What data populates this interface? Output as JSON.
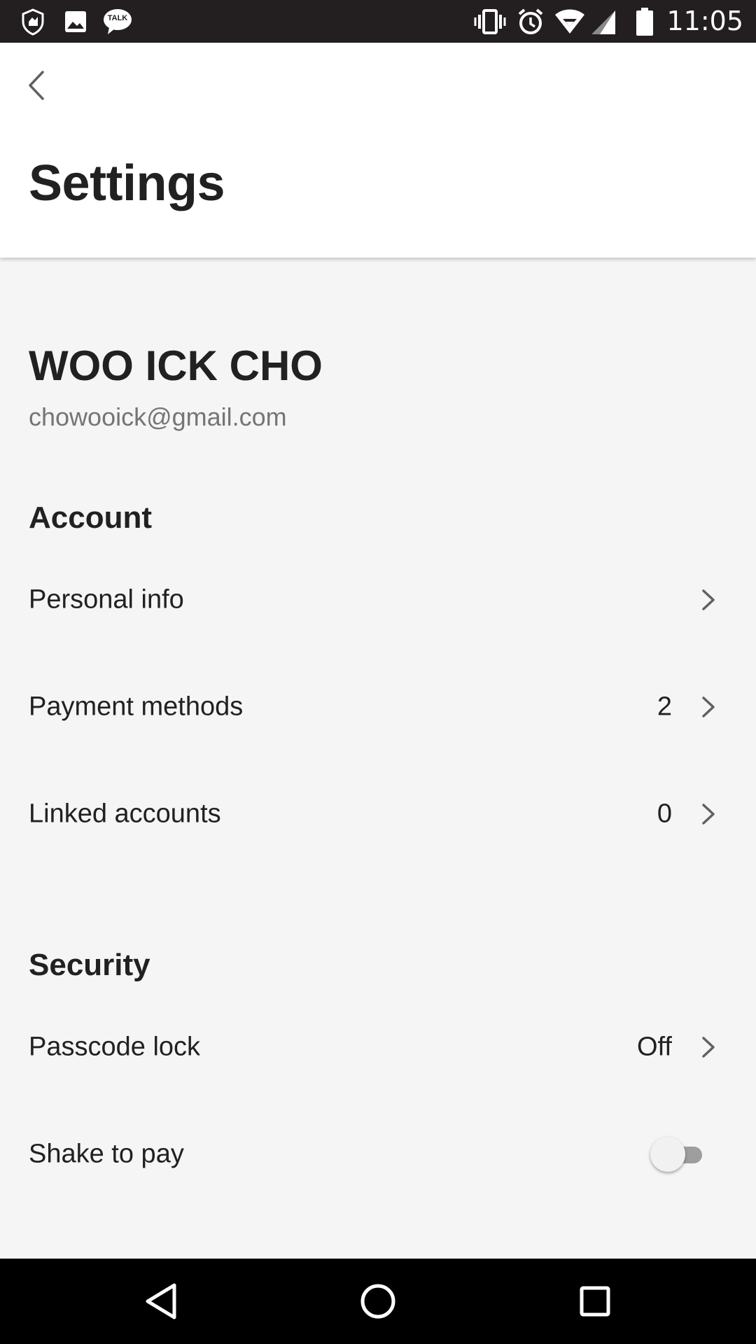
{
  "status_bar": {
    "time": "11:05",
    "left_icons": [
      "shield-notification-icon",
      "image-notification-icon",
      "talk-notification-icon"
    ],
    "talk_badge": "TALK",
    "right_icons": [
      "vibrate-icon",
      "alarm-icon",
      "wifi-icon",
      "signal-icon",
      "battery-icon"
    ]
  },
  "header": {
    "back_icon": "chevron-left-icon",
    "title": "Settings"
  },
  "profile": {
    "name": "WOO ICK CHO",
    "email": "chowooick@gmail.com"
  },
  "account": {
    "header": "Account",
    "items": [
      {
        "label": "Personal info",
        "value": ""
      },
      {
        "label": "Payment methods",
        "value": "2"
      },
      {
        "label": "Linked accounts",
        "value": "0"
      }
    ]
  },
  "security": {
    "header": "Security",
    "passcode": {
      "label": "Passcode lock",
      "value": "Off"
    },
    "shake": {
      "label": "Shake to pay",
      "enabled": false
    }
  },
  "nav_bar": {
    "icons": [
      "back-triangle-icon",
      "home-circle-icon",
      "recents-square-icon"
    ]
  },
  "colors": {
    "status_bar": "#231f20",
    "app_bar": "#ffffff",
    "background": "#f5f5f5",
    "text_primary": "#212121",
    "text_secondary": "#757575",
    "chevron": "#616161",
    "nav_bar": "#000000"
  }
}
